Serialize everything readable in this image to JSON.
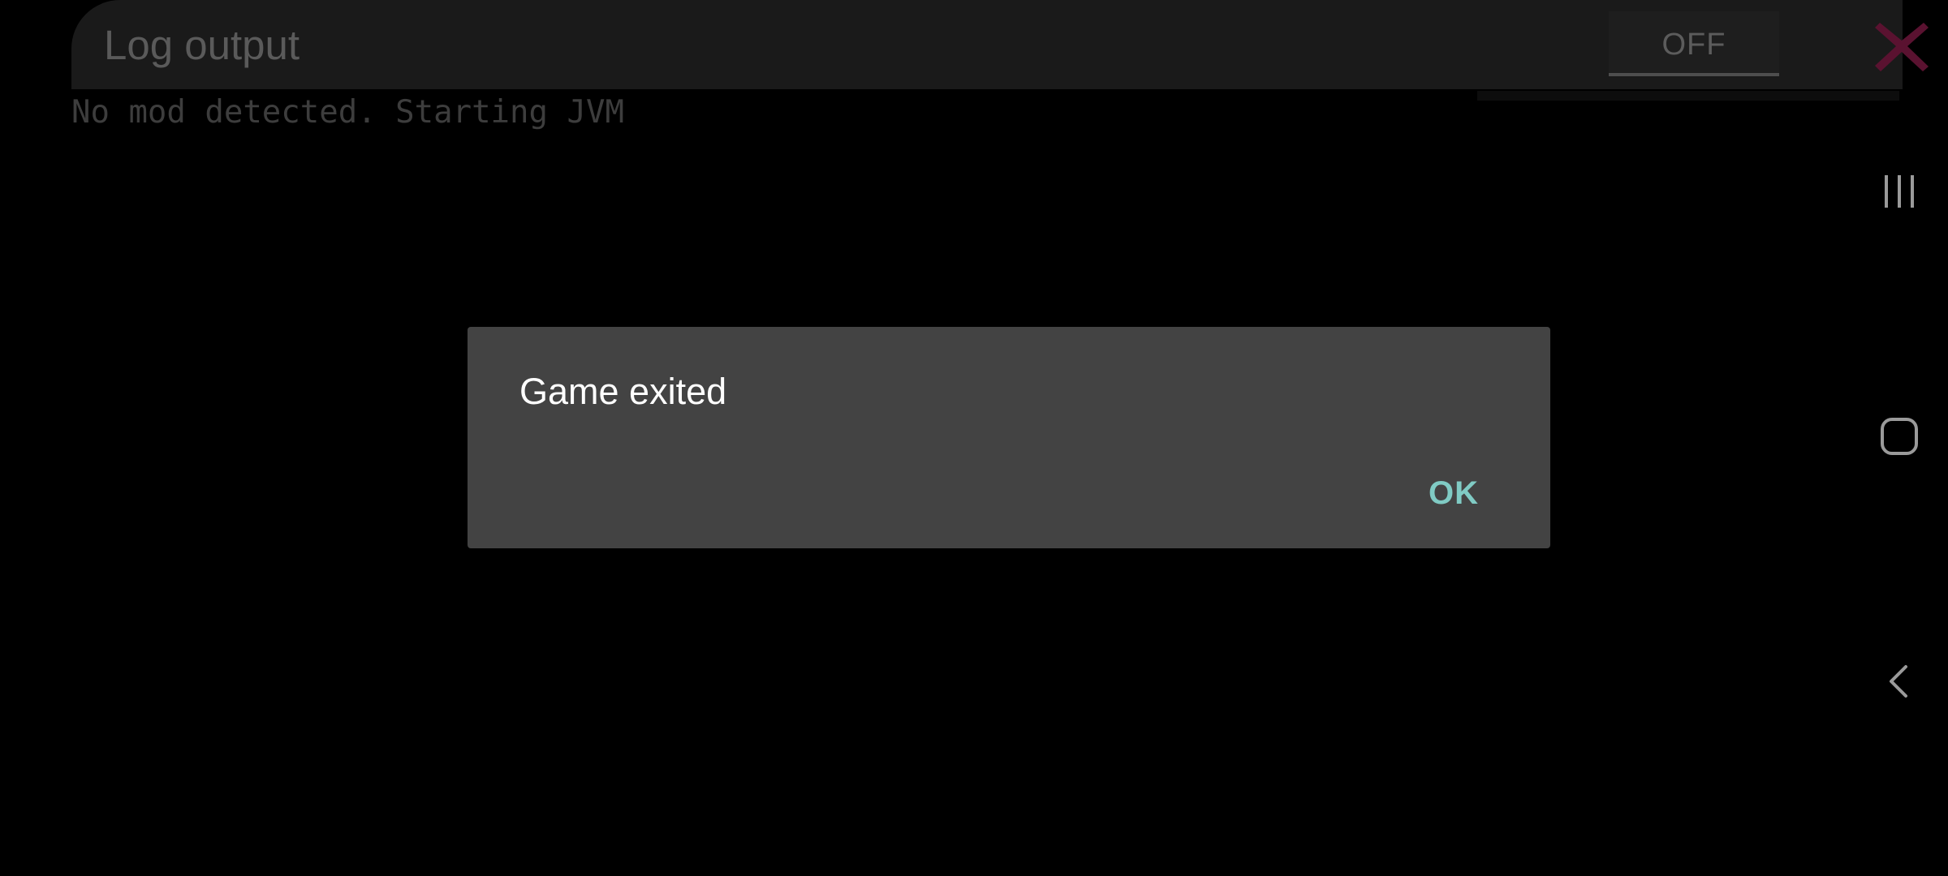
{
  "log_window": {
    "title": "Log output",
    "toggle_label": "OFF",
    "lines": [
      "No mod detected. Starting JVM"
    ],
    "close_icon": "close-icon"
  },
  "dialog": {
    "title": "Game exited",
    "ok_label": "OK"
  },
  "nav_bar": {
    "recents_icon": "recents-icon",
    "home_icon": "home-icon",
    "back_icon": "back-icon"
  },
  "colors": {
    "background": "#000000",
    "dialog_bg": "#434343",
    "accent": "#80cbc4",
    "close_icon": "#5a1230"
  }
}
